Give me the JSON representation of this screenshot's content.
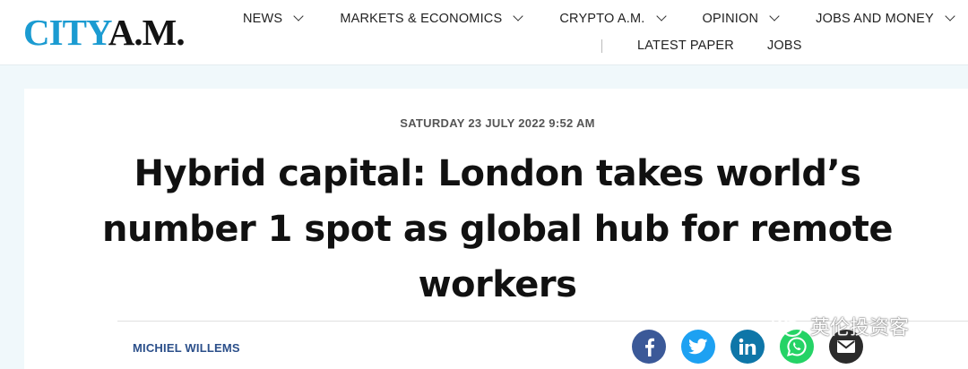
{
  "brand": {
    "logo_city": "CITY",
    "logo_am": "A.M."
  },
  "nav": {
    "primary": [
      {
        "label": "NEWS",
        "has_dropdown": true
      },
      {
        "label": "MARKETS & ECONOMICS",
        "has_dropdown": true
      },
      {
        "label": "CRYPTO A.M.",
        "has_dropdown": true
      },
      {
        "label": "OPINION",
        "has_dropdown": true
      },
      {
        "label": "JOBS AND MONEY",
        "has_dropdown": true
      }
    ],
    "secondary": [
      {
        "label": "LATEST PAPER"
      },
      {
        "label": "JOBS"
      }
    ]
  },
  "article": {
    "dateline": "SATURDAY 23 JULY 2022 9:52 AM",
    "headline": "Hybrid capital: London takes world’s number 1 spot as global hub for remote workers",
    "author": "MICHIEL WILLEMS"
  },
  "share": [
    {
      "network": "facebook",
      "icon": "facebook-icon",
      "color": "#3b5998"
    },
    {
      "network": "twitter",
      "icon": "twitter-icon",
      "color": "#1da1f2"
    },
    {
      "network": "linkedin",
      "icon": "linkedin-icon",
      "color": "#0e76a8"
    },
    {
      "network": "whatsapp",
      "icon": "whatsapp-icon",
      "color": "#25d366"
    },
    {
      "network": "email",
      "icon": "envelope-icon",
      "color": "#2b2b2b"
    }
  ],
  "watermark": {
    "text": "英伦投资客",
    "icon": "wechat-icon"
  },
  "colors": {
    "brand_blue": "#1b9bd1",
    "page_background": "#f0f8fb",
    "author_link": "#2b4f8a"
  }
}
